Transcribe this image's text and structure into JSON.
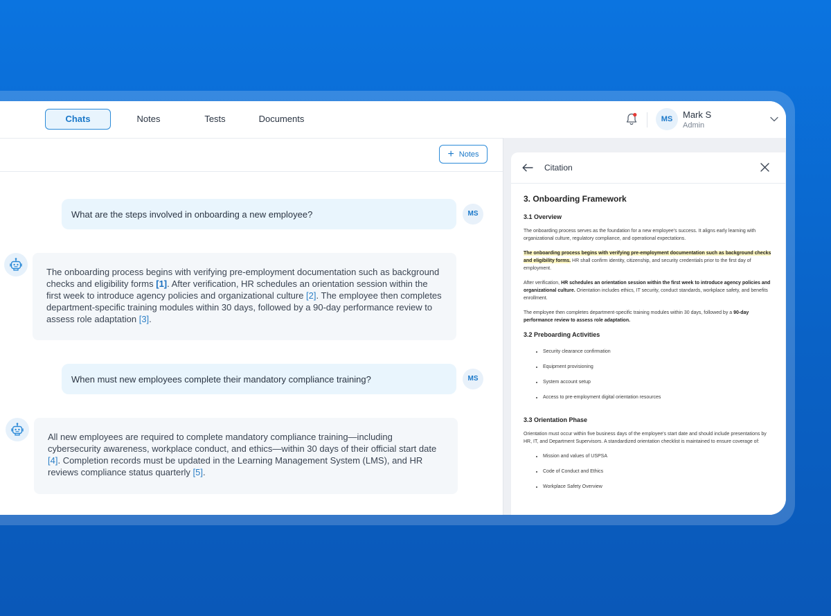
{
  "nav": {
    "tabs": [
      {
        "label": "Chats",
        "active": true
      },
      {
        "label": "Notes",
        "active": false
      },
      {
        "label": "Tests",
        "active": false
      },
      {
        "label": "Documents",
        "active": false
      }
    ]
  },
  "user": {
    "initials": "MS",
    "name": "Mark S",
    "role": "Admin"
  },
  "toolbar": {
    "notes_label": "Notes"
  },
  "chat": {
    "q1": "What are the steps involved in onboarding a new employee?",
    "a1": {
      "t1": "The onboarding process begins with verifying pre-employment documentation such as background checks and eligibility forms ",
      "c1": "[1]",
      "t2": ". After verification, HR schedules an orientation session within the first week to introduce agency policies and organizational culture ",
      "c2": "[2]",
      "t3": ". The employee then completes department-specific training modules within 30 days, followed by a 90-day performance review to assess role adaptation ",
      "c3": "[3]",
      "t4": "."
    },
    "q2": "When must new employees complete their mandatory compliance training?",
    "a2": {
      "t1": "All new employees are required to complete mandatory compliance training—including cybersecurity awareness, workplace conduct, and ethics—within 30 days of their official start date ",
      "c1": "[4]",
      "t2": ". Completion records must be updated in the Learning Management System (LMS), and HR reviews compliance status quarterly ",
      "c2": "[5]",
      "t3": "."
    }
  },
  "citation": {
    "title": "Citation",
    "h1": "3. Onboarding Framework",
    "s1": "3.1 Overview",
    "p1": "The onboarding process serves as the foundation for a new employee's success. It aligns early learning with organizational culture, regulatory compliance, and operational expectations.",
    "p2_mark": "The onboarding process begins with verifying pre-employment documentation such as background checks and eligibility forms.",
    "p2_rest": " HR shall confirm identity, citizenship, and security credentials prior to the first day of employment.",
    "p3_a": "After verification, ",
    "p3_b": "HR schedules an orientation session within the first week to introduce agency policies and organizational culture.",
    "p3_c": " Orientation includes ethics, IT security, conduct standards, workplace safety, and benefits enrollment.",
    "p4_a": "The employee then completes department-specific training modules within 30 days, followed by a ",
    "p4_b": "90-day performance review to assess role adaptation.",
    "s2": "3.2 Preboarding Activities",
    "list1": [
      "Security clearance confirmation",
      "Equipment provisioning",
      "System account setup",
      "Access to pre-employment digital orientation resources"
    ],
    "s3": "3.3 Orientation Phase",
    "p5": "Orientation must occur within five business days of the employee's start date and should include presentations by HR, IT, and Department Supervisors. A standardized orientation checklist is maintained to ensure coverage of:",
    "list2": [
      "Mission and values of USPSA",
      "Code of Conduct and Ethics",
      "Workplace Safety Overview"
    ]
  },
  "colors": {
    "accent": "#2b8ad8",
    "notification": "#e53935"
  }
}
